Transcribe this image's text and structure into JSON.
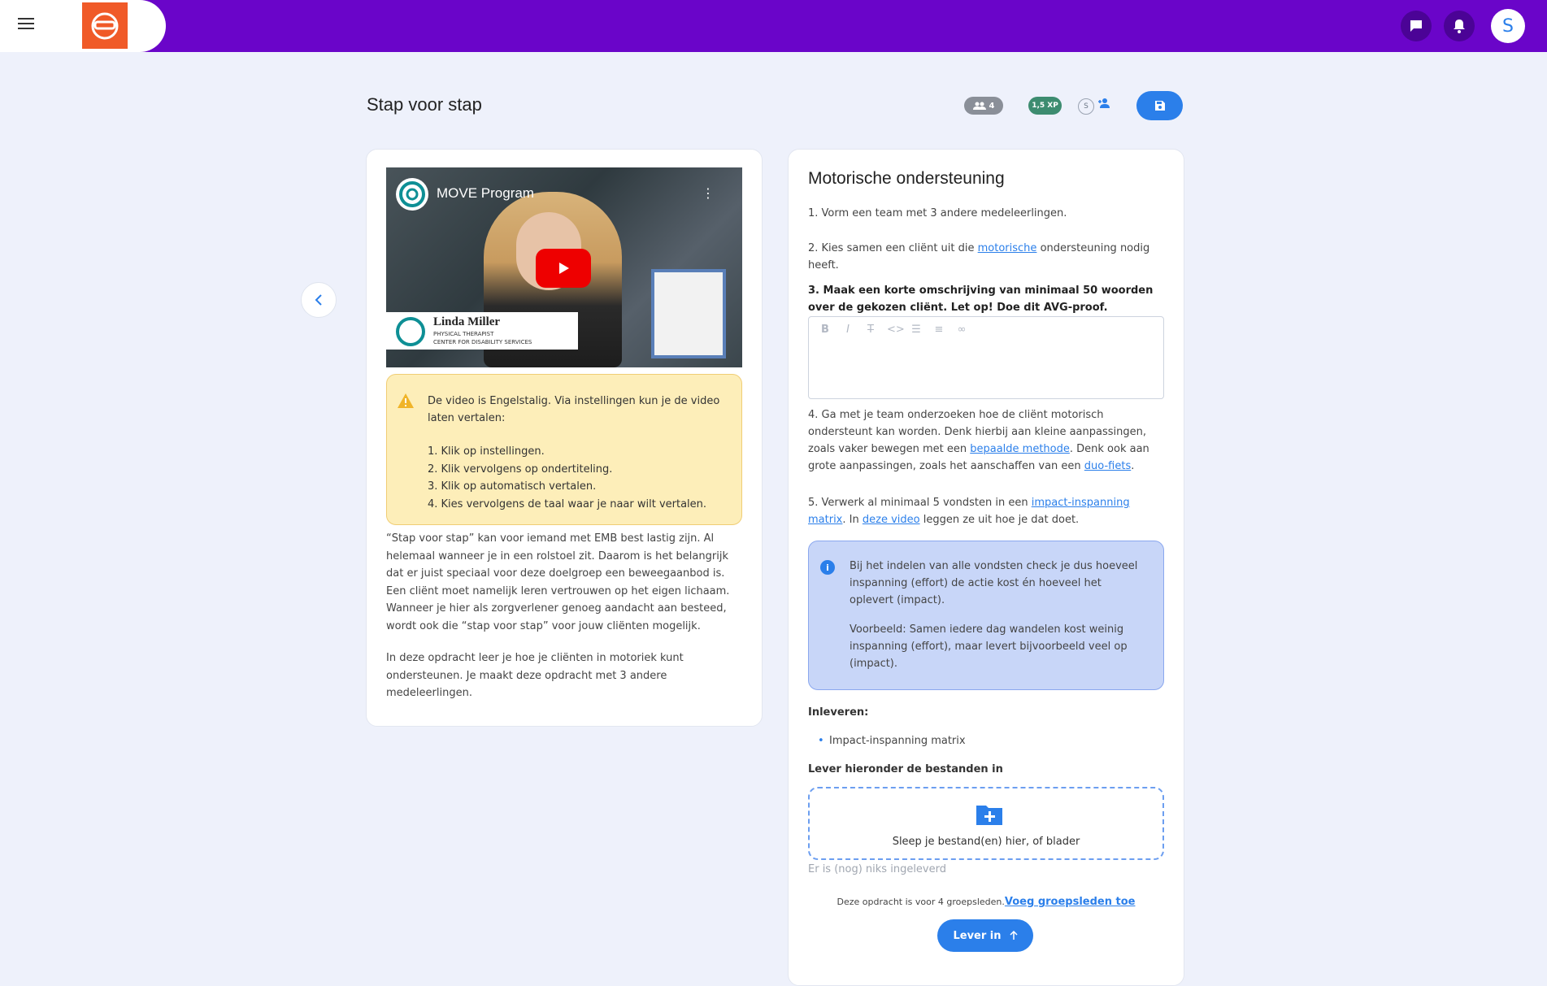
{
  "header": {
    "avatar_letter": "S"
  },
  "page": {
    "title": "Stap voor stap",
    "members_count": "4",
    "xp": "1,5 XP",
    "s_label": "S"
  },
  "video": {
    "title": "MOVE Program",
    "presenter_name": "Linda Miller",
    "presenter_role": "PHYSICAL THERAPIST",
    "presenter_org": "CENTER FOR DISABILITY SERVICES"
  },
  "warning": {
    "text": "De video is Engelstalig. Via instellingen kun je de video laten vertalen:",
    "steps": [
      "1. Klik op instellingen.",
      "2. Klik vervolgens op ondertiteling.",
      "3. Klik op automatisch vertalen.",
      "4. Kies vervolgens de taal waar je naar wilt vertalen."
    ]
  },
  "intro": {
    "p1": "“Stap voor stap” kan voor iemand met EMB best lastig zijn. Al helemaal wanneer je in een rolstoel zit. Daarom is het belangrijk dat er juist speciaal voor deze doelgroep een beweegaanbod is. Een cliënt moet namelijk leren vertrouwen op het eigen lichaam. Wanneer je hier als zorgverlener genoeg aandacht aan besteed, wordt ook die “stap voor stap” voor jouw cliënten mogelijk.",
    "p2": "In deze opdracht leer je hoe je cliënten in motoriek kunt ondersteunen. Je maakt deze opdracht met 3 andere medeleerlingen."
  },
  "assignment": {
    "title": "Motorische ondersteuning",
    "step1": "1. Vorm een team met 3 andere medeleerlingen.",
    "step2_a": "2. Kies samen een cliënt uit die ",
    "step2_link": "motorische",
    "step2_b": " ondersteuning nodig heeft.",
    "step3": "3. Maak een korte omschrijving van minimaal 50 woorden over de gekozen cliënt. Let op! Doe dit AVG-proof.",
    "step4_a": "4. Ga met je team onderzoeken hoe de cliënt motorisch ondersteunt kan worden. Denk hierbij aan kleine aanpassingen, zoals vaker bewegen met een ",
    "step4_link1": "bepaalde methode",
    "step4_b": ". Denk ook aan grote aanpassingen, zoals het aanschaffen van een ",
    "step4_link2": "duo-fiets",
    "step4_c": ".",
    "step5_a": "5. Verwerk al minimaal 5 vondsten in een ",
    "step5_link1": "impact-inspanning matrix",
    "step5_b": ". In ",
    "step5_link2": "deze video",
    "step5_c": " leggen ze uit hoe je dat doet.",
    "info_p1": "Bij het indelen van alle vondsten check je dus hoeveel inspanning (effort) de actie kost én hoeveel het oplevert (impact).",
    "info_p2": "Voorbeeld: Samen iedere dag wandelen kost weinig inspanning (effort), maar levert bijvoorbeeld veel op (impact).",
    "deliver_label": "Inleveren:",
    "deliver_item": "Impact-inspanning matrix",
    "upload_label": "Lever hieronder de bestanden in",
    "dropzone_text": "Sleep je bestand(en) hier, of blader",
    "empty_text": "Er is (nog) niks ingeleverd",
    "group_note": "Deze opdracht is voor 4 groepsleden.",
    "group_link": "Voeg groepsleden toe",
    "submit_label": "Lever in"
  },
  "colors": {
    "topbar": "#6a05c9",
    "accent": "#2b7fea",
    "logo": "#f05a28",
    "warning_bg": "#fdeeb9",
    "info_bg": "#c8d6f8"
  }
}
